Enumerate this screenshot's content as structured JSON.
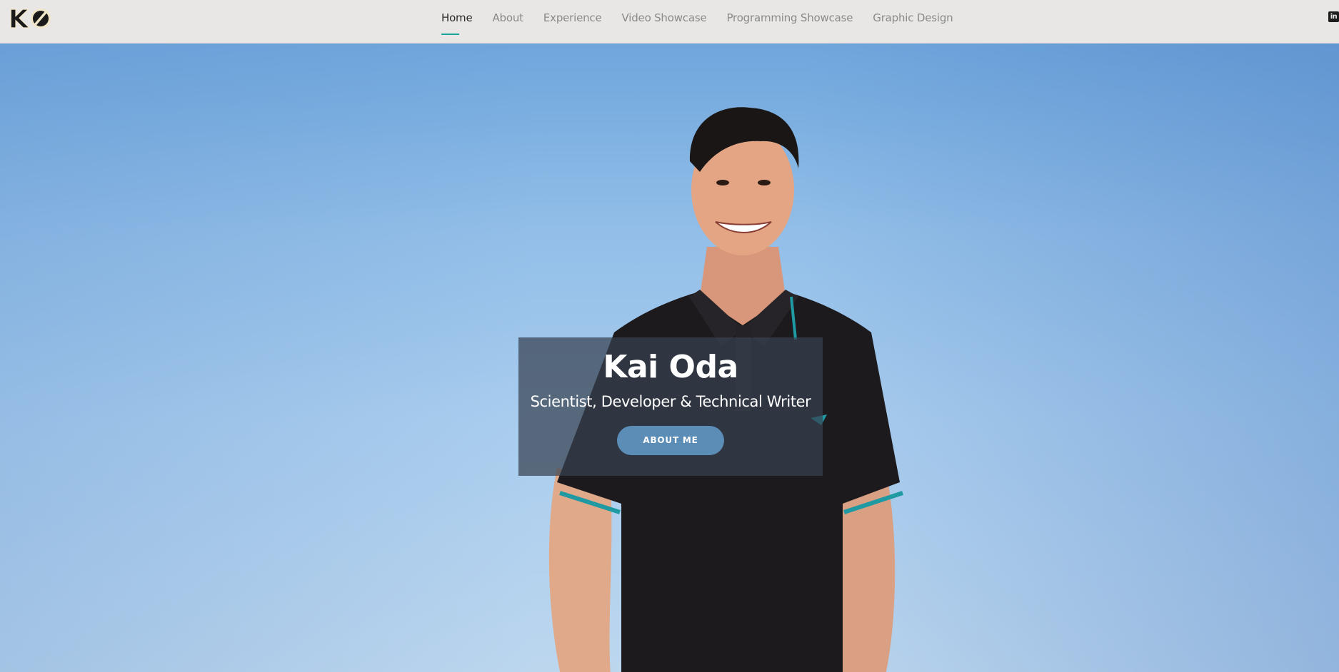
{
  "nav": {
    "logo_text": "KO",
    "links": [
      {
        "label": "Home",
        "active": true
      },
      {
        "label": "About",
        "active": false
      },
      {
        "label": "Experience",
        "active": false
      },
      {
        "label": "Video Showcase",
        "active": false
      },
      {
        "label": "Programming Showcase",
        "active": false
      },
      {
        "label": "Graphic Design",
        "active": false
      }
    ],
    "social_icon": "linkedin-icon",
    "social_label": "in"
  },
  "hero": {
    "name": "Kai Oda",
    "subtitle": "Scientist, Developer & Technical Writer",
    "button_label": "ABOUT ME"
  },
  "colors": {
    "nav_background": "#e8e7e5",
    "active_underline": "#1aa39a",
    "button": "#5b8db7",
    "card_overlay": "rgba(55,65,80,0.72)"
  }
}
